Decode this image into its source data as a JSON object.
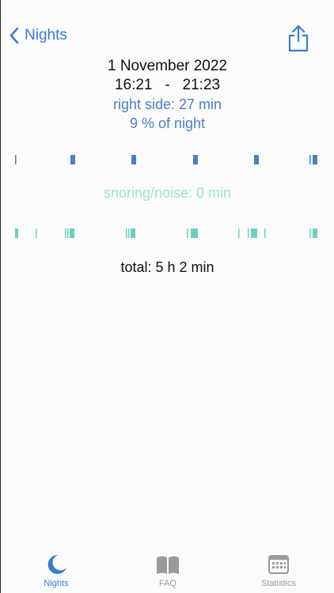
{
  "nav": {
    "back_label": "Nights"
  },
  "header": {
    "date": "1 November 2022",
    "time_range": "16:21   -   21:23",
    "right_side": "right side: 27 min",
    "percent_night": "9 % of night"
  },
  "snoring": {
    "label": "snoring/noise: 0 min"
  },
  "total": {
    "label": "total: 5 h 2 min"
  },
  "colors": {
    "accent": "#3a7bd5",
    "side_marks": "#4a7fc2",
    "snore_marks": "#6ccfc0",
    "inactive": "#9a9a9a"
  },
  "tabs": [
    {
      "label": "Nights",
      "icon": "moon-icon",
      "active": true
    },
    {
      "label": "FAQ",
      "icon": "book-icon",
      "active": false
    },
    {
      "label": "Statistics",
      "icon": "calendar-icon",
      "active": false
    }
  ]
}
